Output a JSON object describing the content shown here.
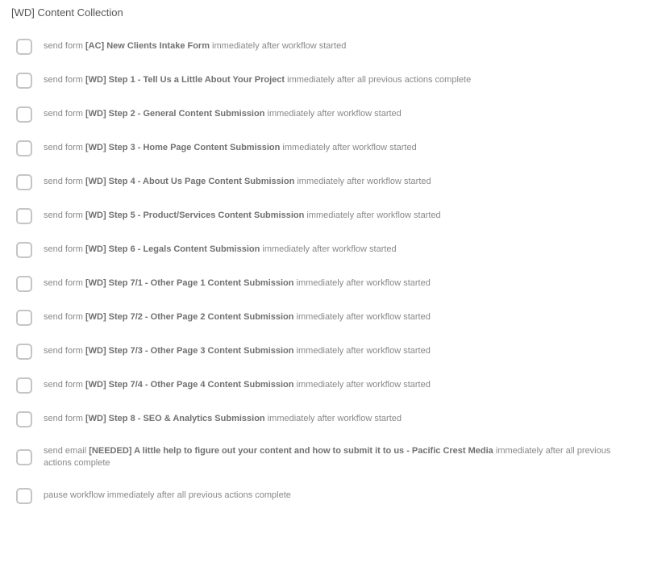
{
  "header": "[WD] Content Collection",
  "items": [
    {
      "prefix": "send form ",
      "bold": "[AC] New Clients Intake Form",
      "suffix": " immediately after workflow started"
    },
    {
      "prefix": "send form ",
      "bold": "[WD] Step 1 - Tell Us a Little About Your Project",
      "suffix": " immediately after all previous actions complete"
    },
    {
      "prefix": "send form ",
      "bold": "[WD] Step 2 - General Content Submission",
      "suffix": " immediately after workflow started"
    },
    {
      "prefix": "send form ",
      "bold": "[WD] Step 3 - Home Page Content Submission",
      "suffix": " immediately after workflow started"
    },
    {
      "prefix": "send form ",
      "bold": "[WD] Step 4 - About Us Page Content Submission",
      "suffix": " immediately after workflow started"
    },
    {
      "prefix": "send form ",
      "bold": "[WD] Step 5 - Product/Services Content Submission",
      "suffix": " immediately after workflow started"
    },
    {
      "prefix": "send form ",
      "bold": "[WD] Step 6 - Legals Content Submission",
      "suffix": " immediately after workflow started"
    },
    {
      "prefix": "send form ",
      "bold": "[WD] Step 7/1 - Other Page 1 Content Submission",
      "suffix": " immediately after workflow started"
    },
    {
      "prefix": "send form ",
      "bold": "[WD] Step 7/2 - Other Page 2 Content Submission",
      "suffix": " immediately after workflow started"
    },
    {
      "prefix": "send form ",
      "bold": "[WD] Step 7/3 - Other Page 3 Content Submission",
      "suffix": " immediately after workflow started"
    },
    {
      "prefix": "send form ",
      "bold": "[WD] Step 7/4 - Other Page 4 Content Submission",
      "suffix": " immediately after workflow started"
    },
    {
      "prefix": "send form ",
      "bold": "[WD] Step 8 - SEO & Analytics Submission",
      "suffix": " immediately after workflow started"
    },
    {
      "prefix": "send email ",
      "bold": "[NEEDED] A little help to figure out your content and how to submit it to us - Pacific Crest Media",
      "suffix": " immediately after all previous actions complete"
    },
    {
      "prefix": "pause workflow immediately after all previous actions complete",
      "bold": "",
      "suffix": ""
    }
  ]
}
